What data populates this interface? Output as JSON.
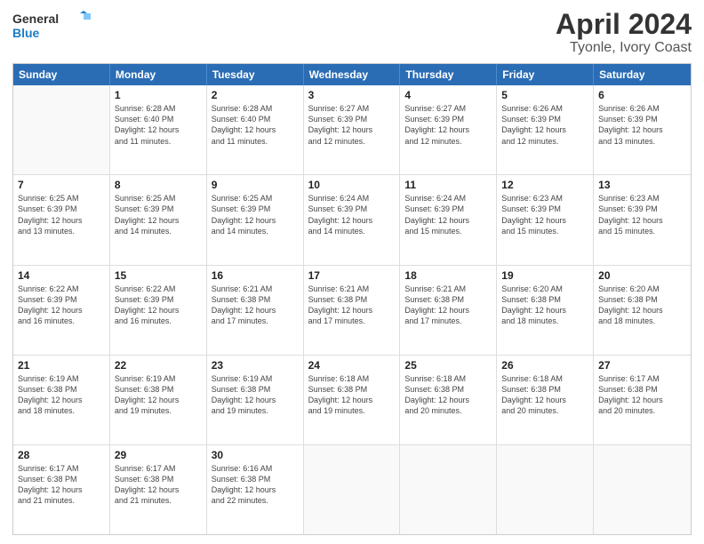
{
  "logo": {
    "line1": "General",
    "line2": "Blue"
  },
  "title": "April 2024",
  "subtitle": "Tyonle, Ivory Coast",
  "days": [
    "Sunday",
    "Monday",
    "Tuesday",
    "Wednesday",
    "Thursday",
    "Friday",
    "Saturday"
  ],
  "rows": [
    [
      {
        "num": "",
        "info": ""
      },
      {
        "num": "1",
        "info": "Sunrise: 6:28 AM\nSunset: 6:40 PM\nDaylight: 12 hours\nand 11 minutes."
      },
      {
        "num": "2",
        "info": "Sunrise: 6:28 AM\nSunset: 6:40 PM\nDaylight: 12 hours\nand 11 minutes."
      },
      {
        "num": "3",
        "info": "Sunrise: 6:27 AM\nSunset: 6:39 PM\nDaylight: 12 hours\nand 12 minutes."
      },
      {
        "num": "4",
        "info": "Sunrise: 6:27 AM\nSunset: 6:39 PM\nDaylight: 12 hours\nand 12 minutes."
      },
      {
        "num": "5",
        "info": "Sunrise: 6:26 AM\nSunset: 6:39 PM\nDaylight: 12 hours\nand 12 minutes."
      },
      {
        "num": "6",
        "info": "Sunrise: 6:26 AM\nSunset: 6:39 PM\nDaylight: 12 hours\nand 13 minutes."
      }
    ],
    [
      {
        "num": "7",
        "info": "Sunrise: 6:25 AM\nSunset: 6:39 PM\nDaylight: 12 hours\nand 13 minutes."
      },
      {
        "num": "8",
        "info": "Sunrise: 6:25 AM\nSunset: 6:39 PM\nDaylight: 12 hours\nand 14 minutes."
      },
      {
        "num": "9",
        "info": "Sunrise: 6:25 AM\nSunset: 6:39 PM\nDaylight: 12 hours\nand 14 minutes."
      },
      {
        "num": "10",
        "info": "Sunrise: 6:24 AM\nSunset: 6:39 PM\nDaylight: 12 hours\nand 14 minutes."
      },
      {
        "num": "11",
        "info": "Sunrise: 6:24 AM\nSunset: 6:39 PM\nDaylight: 12 hours\nand 15 minutes."
      },
      {
        "num": "12",
        "info": "Sunrise: 6:23 AM\nSunset: 6:39 PM\nDaylight: 12 hours\nand 15 minutes."
      },
      {
        "num": "13",
        "info": "Sunrise: 6:23 AM\nSunset: 6:39 PM\nDaylight: 12 hours\nand 15 minutes."
      }
    ],
    [
      {
        "num": "14",
        "info": "Sunrise: 6:22 AM\nSunset: 6:39 PM\nDaylight: 12 hours\nand 16 minutes."
      },
      {
        "num": "15",
        "info": "Sunrise: 6:22 AM\nSunset: 6:39 PM\nDaylight: 12 hours\nand 16 minutes."
      },
      {
        "num": "16",
        "info": "Sunrise: 6:21 AM\nSunset: 6:38 PM\nDaylight: 12 hours\nand 17 minutes."
      },
      {
        "num": "17",
        "info": "Sunrise: 6:21 AM\nSunset: 6:38 PM\nDaylight: 12 hours\nand 17 minutes."
      },
      {
        "num": "18",
        "info": "Sunrise: 6:21 AM\nSunset: 6:38 PM\nDaylight: 12 hours\nand 17 minutes."
      },
      {
        "num": "19",
        "info": "Sunrise: 6:20 AM\nSunset: 6:38 PM\nDaylight: 12 hours\nand 18 minutes."
      },
      {
        "num": "20",
        "info": "Sunrise: 6:20 AM\nSunset: 6:38 PM\nDaylight: 12 hours\nand 18 minutes."
      }
    ],
    [
      {
        "num": "21",
        "info": "Sunrise: 6:19 AM\nSunset: 6:38 PM\nDaylight: 12 hours\nand 18 minutes."
      },
      {
        "num": "22",
        "info": "Sunrise: 6:19 AM\nSunset: 6:38 PM\nDaylight: 12 hours\nand 19 minutes."
      },
      {
        "num": "23",
        "info": "Sunrise: 6:19 AM\nSunset: 6:38 PM\nDaylight: 12 hours\nand 19 minutes."
      },
      {
        "num": "24",
        "info": "Sunrise: 6:18 AM\nSunset: 6:38 PM\nDaylight: 12 hours\nand 19 minutes."
      },
      {
        "num": "25",
        "info": "Sunrise: 6:18 AM\nSunset: 6:38 PM\nDaylight: 12 hours\nand 20 minutes."
      },
      {
        "num": "26",
        "info": "Sunrise: 6:18 AM\nSunset: 6:38 PM\nDaylight: 12 hours\nand 20 minutes."
      },
      {
        "num": "27",
        "info": "Sunrise: 6:17 AM\nSunset: 6:38 PM\nDaylight: 12 hours\nand 20 minutes."
      }
    ],
    [
      {
        "num": "28",
        "info": "Sunrise: 6:17 AM\nSunset: 6:38 PM\nDaylight: 12 hours\nand 21 minutes."
      },
      {
        "num": "29",
        "info": "Sunrise: 6:17 AM\nSunset: 6:38 PM\nDaylight: 12 hours\nand 21 minutes."
      },
      {
        "num": "30",
        "info": "Sunrise: 6:16 AM\nSunset: 6:38 PM\nDaylight: 12 hours\nand 22 minutes."
      },
      {
        "num": "",
        "info": ""
      },
      {
        "num": "",
        "info": ""
      },
      {
        "num": "",
        "info": ""
      },
      {
        "num": "",
        "info": ""
      }
    ]
  ]
}
